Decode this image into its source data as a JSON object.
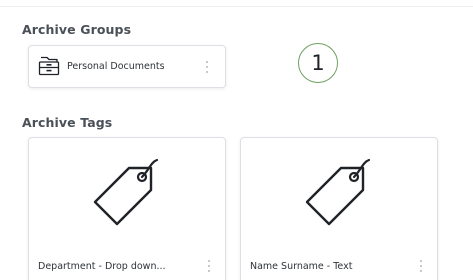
{
  "archive_groups": {
    "title": "Archive Groups",
    "items": [
      {
        "label": "Personal Documents",
        "icon": "file-cabinet-icon"
      }
    ]
  },
  "step_badge": "1",
  "archive_tags": {
    "title": "Archive Tags",
    "items": [
      {
        "label": "Department - Drop down...",
        "icon": "tag-icon"
      },
      {
        "label": "Name Surname - Text",
        "icon": "tag-icon"
      }
    ]
  },
  "colors": {
    "badge_border": "#6e9f63",
    "title_text": "#4a5058",
    "card_border": "#dcdfe3"
  }
}
